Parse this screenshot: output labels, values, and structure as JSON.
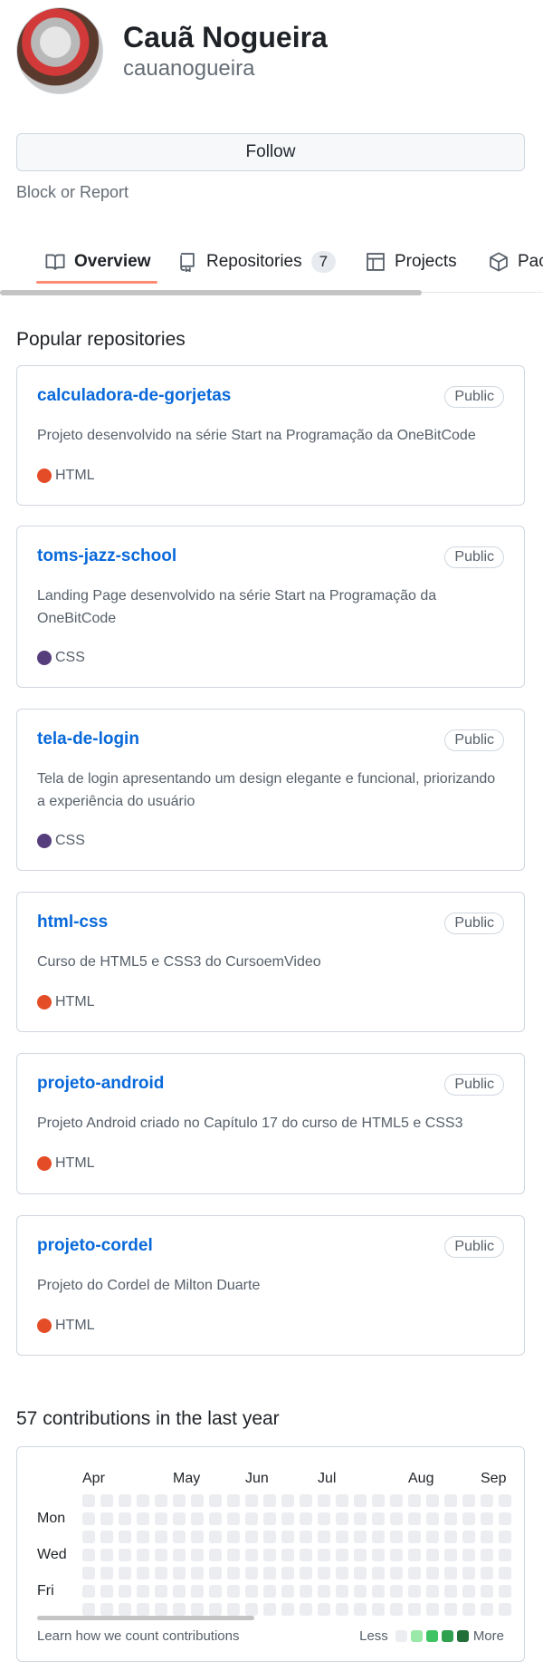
{
  "profile": {
    "fullname": "Cauã Nogueira",
    "username": "cauanogueira"
  },
  "actions": {
    "follow_label": "Follow",
    "block_label": "Block or Report"
  },
  "tabs": [
    {
      "label": "Overview",
      "icon": "book-icon",
      "active": true
    },
    {
      "label": "Repositories",
      "count": "7",
      "icon": "repo-icon"
    },
    {
      "label": "Projects",
      "icon": "table-icon"
    },
    {
      "label": "Pac",
      "icon": "package-icon"
    }
  ],
  "popular": {
    "title": "Popular repositories",
    "repos": [
      {
        "name": "calculadora-de-gorjetas",
        "visibility": "Public",
        "description": "Projeto desenvolvido na série Start na Programação da OneBitCode",
        "language": "HTML",
        "language_color": "#e34c26"
      },
      {
        "name": "toms-jazz-school",
        "visibility": "Public",
        "description": "Landing Page desenvolvido na série Start na Programação da OneBitCode",
        "language": "CSS",
        "language_color": "#563d7c"
      },
      {
        "name": "tela-de-login",
        "visibility": "Public",
        "description": "Tela de login apresentando um design elegante e funcional, priorizando a experiência do usuário",
        "language": "CSS",
        "language_color": "#563d7c"
      },
      {
        "name": "html-css",
        "visibility": "Public",
        "description": "Curso de HTML5 e CSS3 do CursoemVideo",
        "language": "HTML",
        "language_color": "#e34c26"
      },
      {
        "name": "projeto-android",
        "visibility": "Public",
        "description": "Projeto Android criado no Capítulo 17 do curso de HTML5 e CSS3",
        "language": "HTML",
        "language_color": "#e34c26"
      },
      {
        "name": "projeto-cordel",
        "visibility": "Public",
        "description": "Projeto do Cordel de Milton Duarte",
        "language": "HTML",
        "language_color": "#e34c26"
      }
    ]
  },
  "contributions": {
    "title": "57 contributions in the last year",
    "months": [
      "Apr",
      "May",
      "Jun",
      "Jul",
      "Aug",
      "Sep"
    ],
    "days": [
      "Mon",
      "Wed",
      "Fri"
    ],
    "learn_link": "Learn how we count contributions",
    "legend_less": "Less",
    "legend_more": "More",
    "legend_colors": [
      "#ebedf0",
      "#9be9a8",
      "#40c463",
      "#30a14e",
      "#216e39"
    ],
    "empty_color": "#ebedf0"
  }
}
